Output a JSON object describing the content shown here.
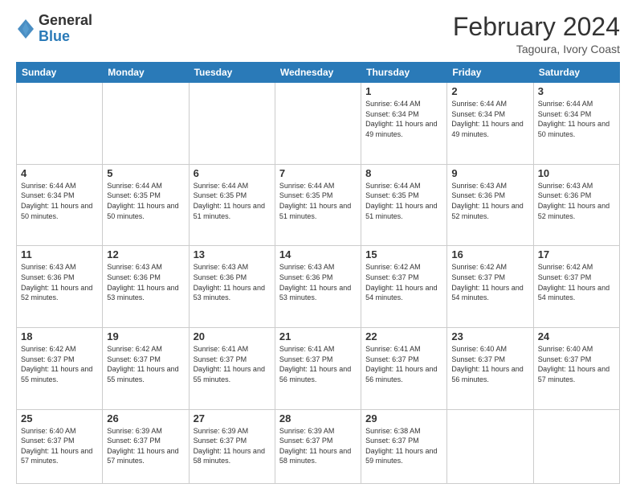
{
  "logo": {
    "general": "General",
    "blue": "Blue"
  },
  "header": {
    "title": "February 2024",
    "subtitle": "Tagoura, Ivory Coast"
  },
  "weekdays": [
    "Sunday",
    "Monday",
    "Tuesday",
    "Wednesday",
    "Thursday",
    "Friday",
    "Saturday"
  ],
  "weeks": [
    [
      {
        "day": "",
        "text": ""
      },
      {
        "day": "",
        "text": ""
      },
      {
        "day": "",
        "text": ""
      },
      {
        "day": "",
        "text": ""
      },
      {
        "day": "1",
        "text": "Sunrise: 6:44 AM\nSunset: 6:34 PM\nDaylight: 11 hours and 49 minutes."
      },
      {
        "day": "2",
        "text": "Sunrise: 6:44 AM\nSunset: 6:34 PM\nDaylight: 11 hours and 49 minutes."
      },
      {
        "day": "3",
        "text": "Sunrise: 6:44 AM\nSunset: 6:34 PM\nDaylight: 11 hours and 50 minutes."
      }
    ],
    [
      {
        "day": "4",
        "text": "Sunrise: 6:44 AM\nSunset: 6:34 PM\nDaylight: 11 hours and 50 minutes."
      },
      {
        "day": "5",
        "text": "Sunrise: 6:44 AM\nSunset: 6:35 PM\nDaylight: 11 hours and 50 minutes."
      },
      {
        "day": "6",
        "text": "Sunrise: 6:44 AM\nSunset: 6:35 PM\nDaylight: 11 hours and 51 minutes."
      },
      {
        "day": "7",
        "text": "Sunrise: 6:44 AM\nSunset: 6:35 PM\nDaylight: 11 hours and 51 minutes."
      },
      {
        "day": "8",
        "text": "Sunrise: 6:44 AM\nSunset: 6:35 PM\nDaylight: 11 hours and 51 minutes."
      },
      {
        "day": "9",
        "text": "Sunrise: 6:43 AM\nSunset: 6:36 PM\nDaylight: 11 hours and 52 minutes."
      },
      {
        "day": "10",
        "text": "Sunrise: 6:43 AM\nSunset: 6:36 PM\nDaylight: 11 hours and 52 minutes."
      }
    ],
    [
      {
        "day": "11",
        "text": "Sunrise: 6:43 AM\nSunset: 6:36 PM\nDaylight: 11 hours and 52 minutes."
      },
      {
        "day": "12",
        "text": "Sunrise: 6:43 AM\nSunset: 6:36 PM\nDaylight: 11 hours and 53 minutes."
      },
      {
        "day": "13",
        "text": "Sunrise: 6:43 AM\nSunset: 6:36 PM\nDaylight: 11 hours and 53 minutes."
      },
      {
        "day": "14",
        "text": "Sunrise: 6:43 AM\nSunset: 6:36 PM\nDaylight: 11 hours and 53 minutes."
      },
      {
        "day": "15",
        "text": "Sunrise: 6:42 AM\nSunset: 6:37 PM\nDaylight: 11 hours and 54 minutes."
      },
      {
        "day": "16",
        "text": "Sunrise: 6:42 AM\nSunset: 6:37 PM\nDaylight: 11 hours and 54 minutes."
      },
      {
        "day": "17",
        "text": "Sunrise: 6:42 AM\nSunset: 6:37 PM\nDaylight: 11 hours and 54 minutes."
      }
    ],
    [
      {
        "day": "18",
        "text": "Sunrise: 6:42 AM\nSunset: 6:37 PM\nDaylight: 11 hours and 55 minutes."
      },
      {
        "day": "19",
        "text": "Sunrise: 6:42 AM\nSunset: 6:37 PM\nDaylight: 11 hours and 55 minutes."
      },
      {
        "day": "20",
        "text": "Sunrise: 6:41 AM\nSunset: 6:37 PM\nDaylight: 11 hours and 55 minutes."
      },
      {
        "day": "21",
        "text": "Sunrise: 6:41 AM\nSunset: 6:37 PM\nDaylight: 11 hours and 56 minutes."
      },
      {
        "day": "22",
        "text": "Sunrise: 6:41 AM\nSunset: 6:37 PM\nDaylight: 11 hours and 56 minutes."
      },
      {
        "day": "23",
        "text": "Sunrise: 6:40 AM\nSunset: 6:37 PM\nDaylight: 11 hours and 56 minutes."
      },
      {
        "day": "24",
        "text": "Sunrise: 6:40 AM\nSunset: 6:37 PM\nDaylight: 11 hours and 57 minutes."
      }
    ],
    [
      {
        "day": "25",
        "text": "Sunrise: 6:40 AM\nSunset: 6:37 PM\nDaylight: 11 hours and 57 minutes."
      },
      {
        "day": "26",
        "text": "Sunrise: 6:39 AM\nSunset: 6:37 PM\nDaylight: 11 hours and 57 minutes."
      },
      {
        "day": "27",
        "text": "Sunrise: 6:39 AM\nSunset: 6:37 PM\nDaylight: 11 hours and 58 minutes."
      },
      {
        "day": "28",
        "text": "Sunrise: 6:39 AM\nSunset: 6:37 PM\nDaylight: 11 hours and 58 minutes."
      },
      {
        "day": "29",
        "text": "Sunrise: 6:38 AM\nSunset: 6:37 PM\nDaylight: 11 hours and 59 minutes."
      },
      {
        "day": "",
        "text": ""
      },
      {
        "day": "",
        "text": ""
      }
    ]
  ]
}
